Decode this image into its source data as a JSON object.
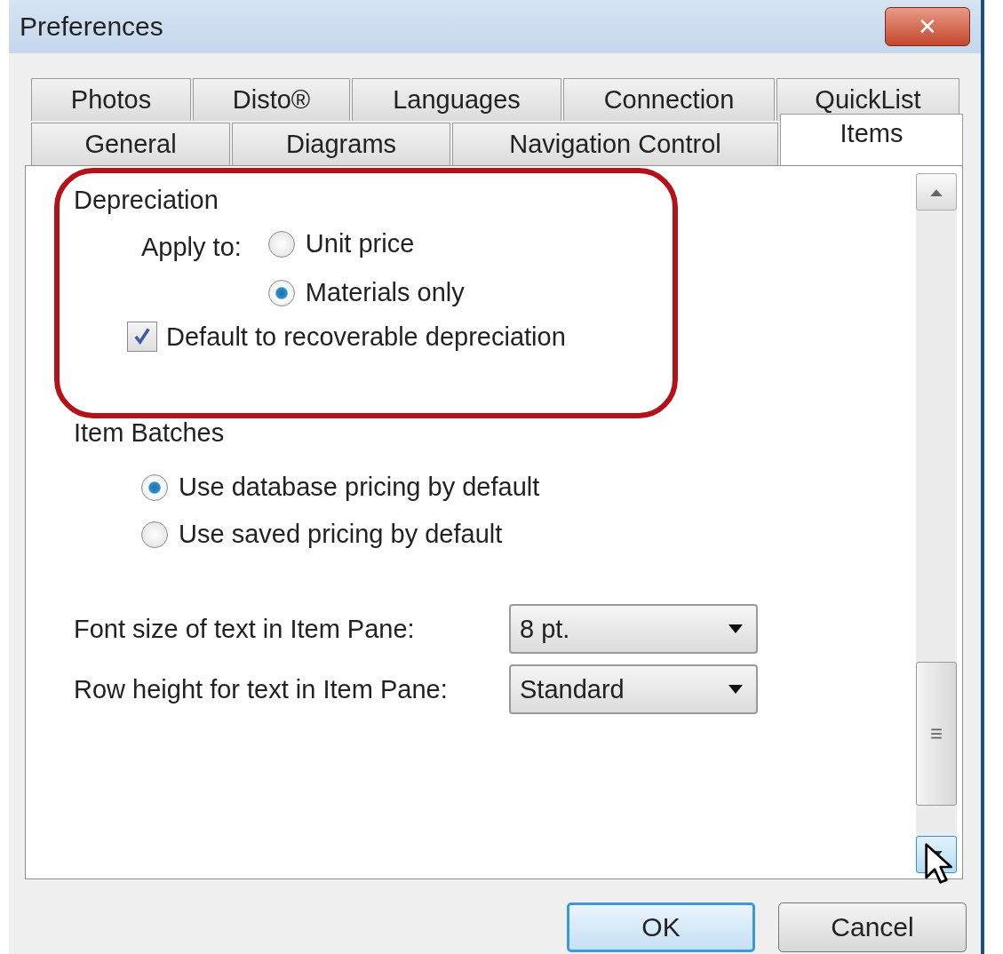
{
  "window": {
    "title": "Preferences",
    "close": "✕"
  },
  "tab_rows": [
    [
      {
        "label": "Photos",
        "selected": false
      },
      {
        "label": "Disto®",
        "selected": false
      },
      {
        "label": "Languages",
        "selected": false
      },
      {
        "label": "Connection",
        "selected": false
      },
      {
        "label": "QuickList",
        "selected": false
      }
    ],
    [
      {
        "label": "General",
        "selected": false
      },
      {
        "label": "Diagrams",
        "selected": false
      },
      {
        "label": "Navigation Control",
        "selected": false
      },
      {
        "label": "Items",
        "selected": true
      }
    ]
  ],
  "depreciation": {
    "title": "Depreciation",
    "highlighted": true,
    "apply_label": "Apply to:",
    "options": [
      {
        "label": "Unit price",
        "selected": false
      },
      {
        "label": "Materials only",
        "selected": true
      }
    ],
    "checkbox": {
      "label": "Default to recoverable depreciation",
      "checked": true
    }
  },
  "item_batches": {
    "title": "Item Batches",
    "options": [
      {
        "label": "Use database pricing by default",
        "selected": true
      },
      {
        "label": "Use saved pricing by default",
        "selected": false
      }
    ]
  },
  "settings": [
    {
      "label": "Font size of text in Item Pane:",
      "value": "8 pt."
    },
    {
      "label": "Row height for text in Item Pane:",
      "value": "Standard"
    }
  ],
  "buttons": [
    {
      "label": "OK",
      "default": true
    },
    {
      "label": "Cancel",
      "default": false
    }
  ]
}
